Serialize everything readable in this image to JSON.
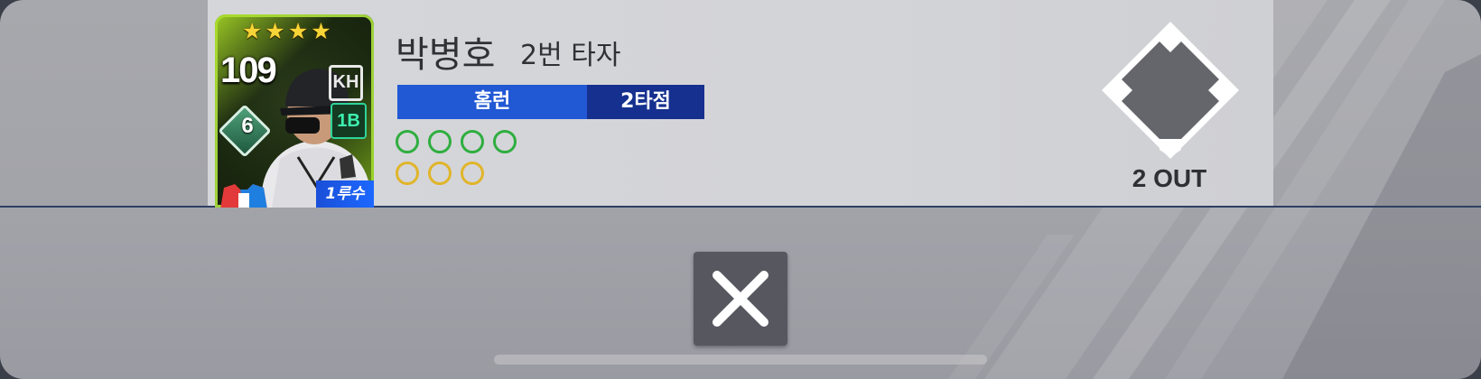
{
  "card": {
    "stars": [
      "★",
      "★",
      "★",
      "★"
    ],
    "rating": "109",
    "level": "6",
    "team_logo": "KH",
    "position": "1B",
    "role_tag": "1루수"
  },
  "player": {
    "name": "박병호",
    "batting_order": "2번 타자"
  },
  "result": {
    "main": "홈런",
    "rbi": "2타점"
  },
  "count": {
    "balls": 4,
    "strikes": 3
  },
  "bases": {
    "first": "empty",
    "second": "empty",
    "third": "empty"
  },
  "outs_label": "2 OUT",
  "close": {
    "icon": "close-icon"
  },
  "colors": {
    "result_main": "#2158d4",
    "result_rbi": "#16308f",
    "ball": "#2fae3f",
    "strike": "#e0b52a"
  }
}
